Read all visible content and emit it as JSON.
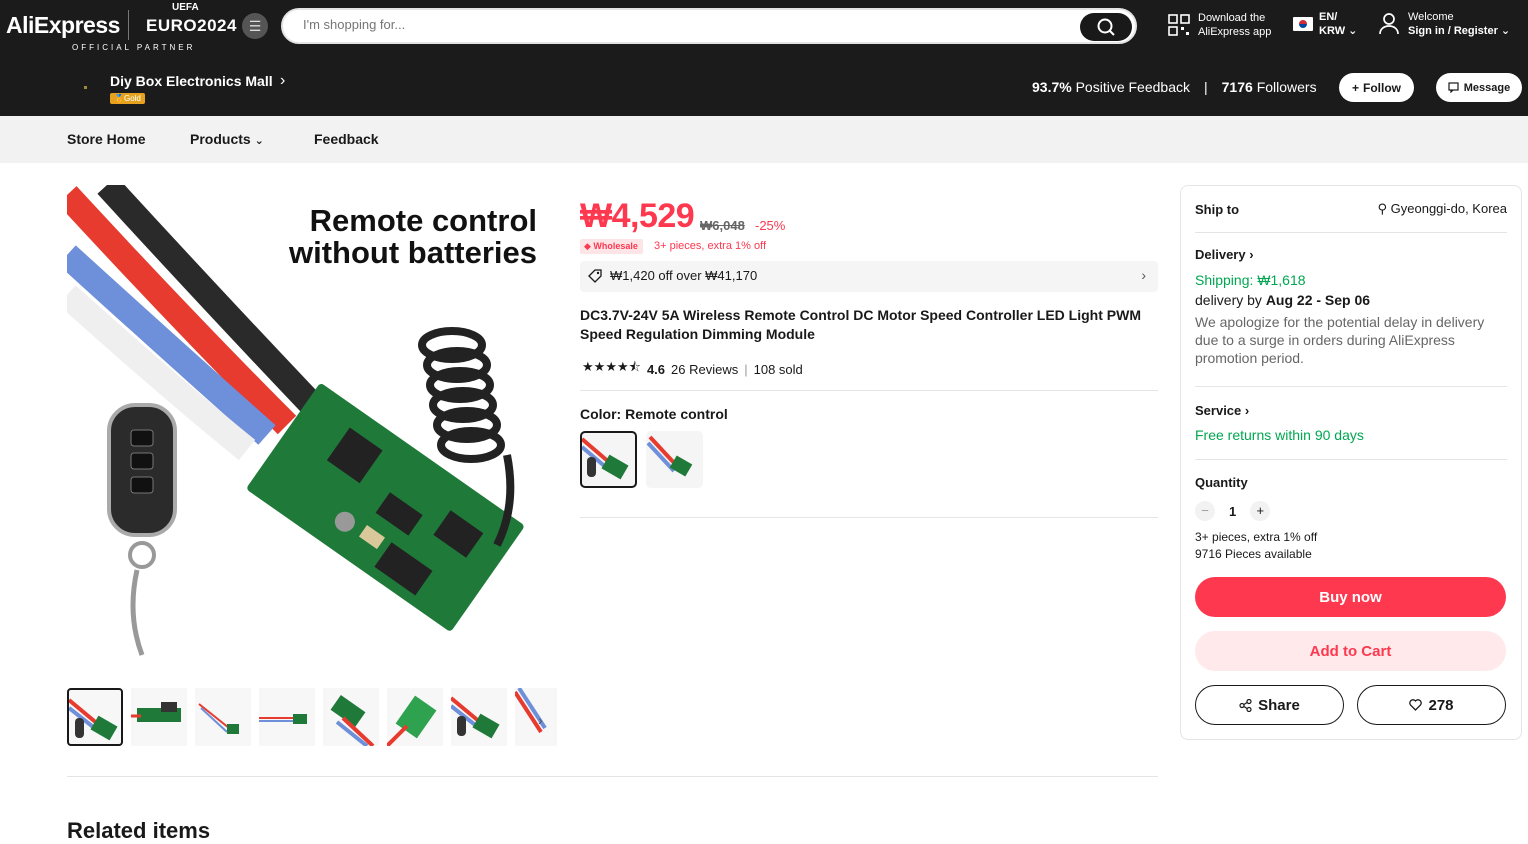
{
  "header": {
    "logo": "AliExpress",
    "euro": "EURO2024",
    "uefa": "UEFA",
    "partner": "OFFICIAL PARTNER",
    "search_placeholder": "I'm shopping for...",
    "download_line1": "Download the",
    "download_line2": "AliExpress app",
    "lang_line1": "EN/",
    "lang_line2": "KRW",
    "welcome": "Welcome",
    "signin": "Sign in / Register"
  },
  "store": {
    "name": "Diy Box Electronics Mall",
    "badge": "Gold",
    "feedback_value": "93.7%",
    "feedback_label": "Positive Feedback",
    "followers_value": "7176",
    "followers_label": "Followers",
    "follow_label": "Follow",
    "message_label": "Message"
  },
  "nav": {
    "items": [
      "Store Home",
      "Products",
      "Feedback"
    ]
  },
  "product": {
    "image_text_line1": "Remote control",
    "image_text_line2": "without batteries",
    "price": "₩4,529",
    "original_price": "₩6,048",
    "discount": "-25%",
    "wholesale_badge": "Wholesale",
    "wholesale_text": "3+ pieces, extra 1% off",
    "coupon": "₩1,420 off over ₩41,170",
    "title": "DC3.7V-24V 5A Wireless Remote Control DC Motor Speed Controller LED Light PWM Speed Regulation Dimming Module",
    "rating": "4.6",
    "reviews": "26 Reviews",
    "sold": "108 sold",
    "color_label": "Color: Remote control",
    "rating_fraction": 0.92
  },
  "side": {
    "ship_to_label": "Ship to",
    "ship_to_value": "Gyeonggi-do, Korea",
    "delivery_label": "Delivery",
    "shipping": "Shipping: ₩1,618",
    "delivery_by_prefix": "delivery by",
    "delivery_dates": "Aug 22 - Sep 06",
    "delay_note": "We apologize for the potential delay in delivery due to a surge in orders during AliExpress promotion period.",
    "service_label": "Service",
    "service_value": "Free returns within 90 days",
    "quantity_label": "Quantity",
    "quantity_value": "1",
    "qty_note": "3+ pieces, extra 1% off",
    "available": "9716 Pieces available",
    "buy_now": "Buy now",
    "add_to_cart": "Add to Cart",
    "share": "Share",
    "wishlist_count": "278"
  },
  "related_title": "Related items",
  "colors": {
    "accent": "#fd384f",
    "green": "#00a651",
    "header_bg": "#1b1b1b"
  }
}
